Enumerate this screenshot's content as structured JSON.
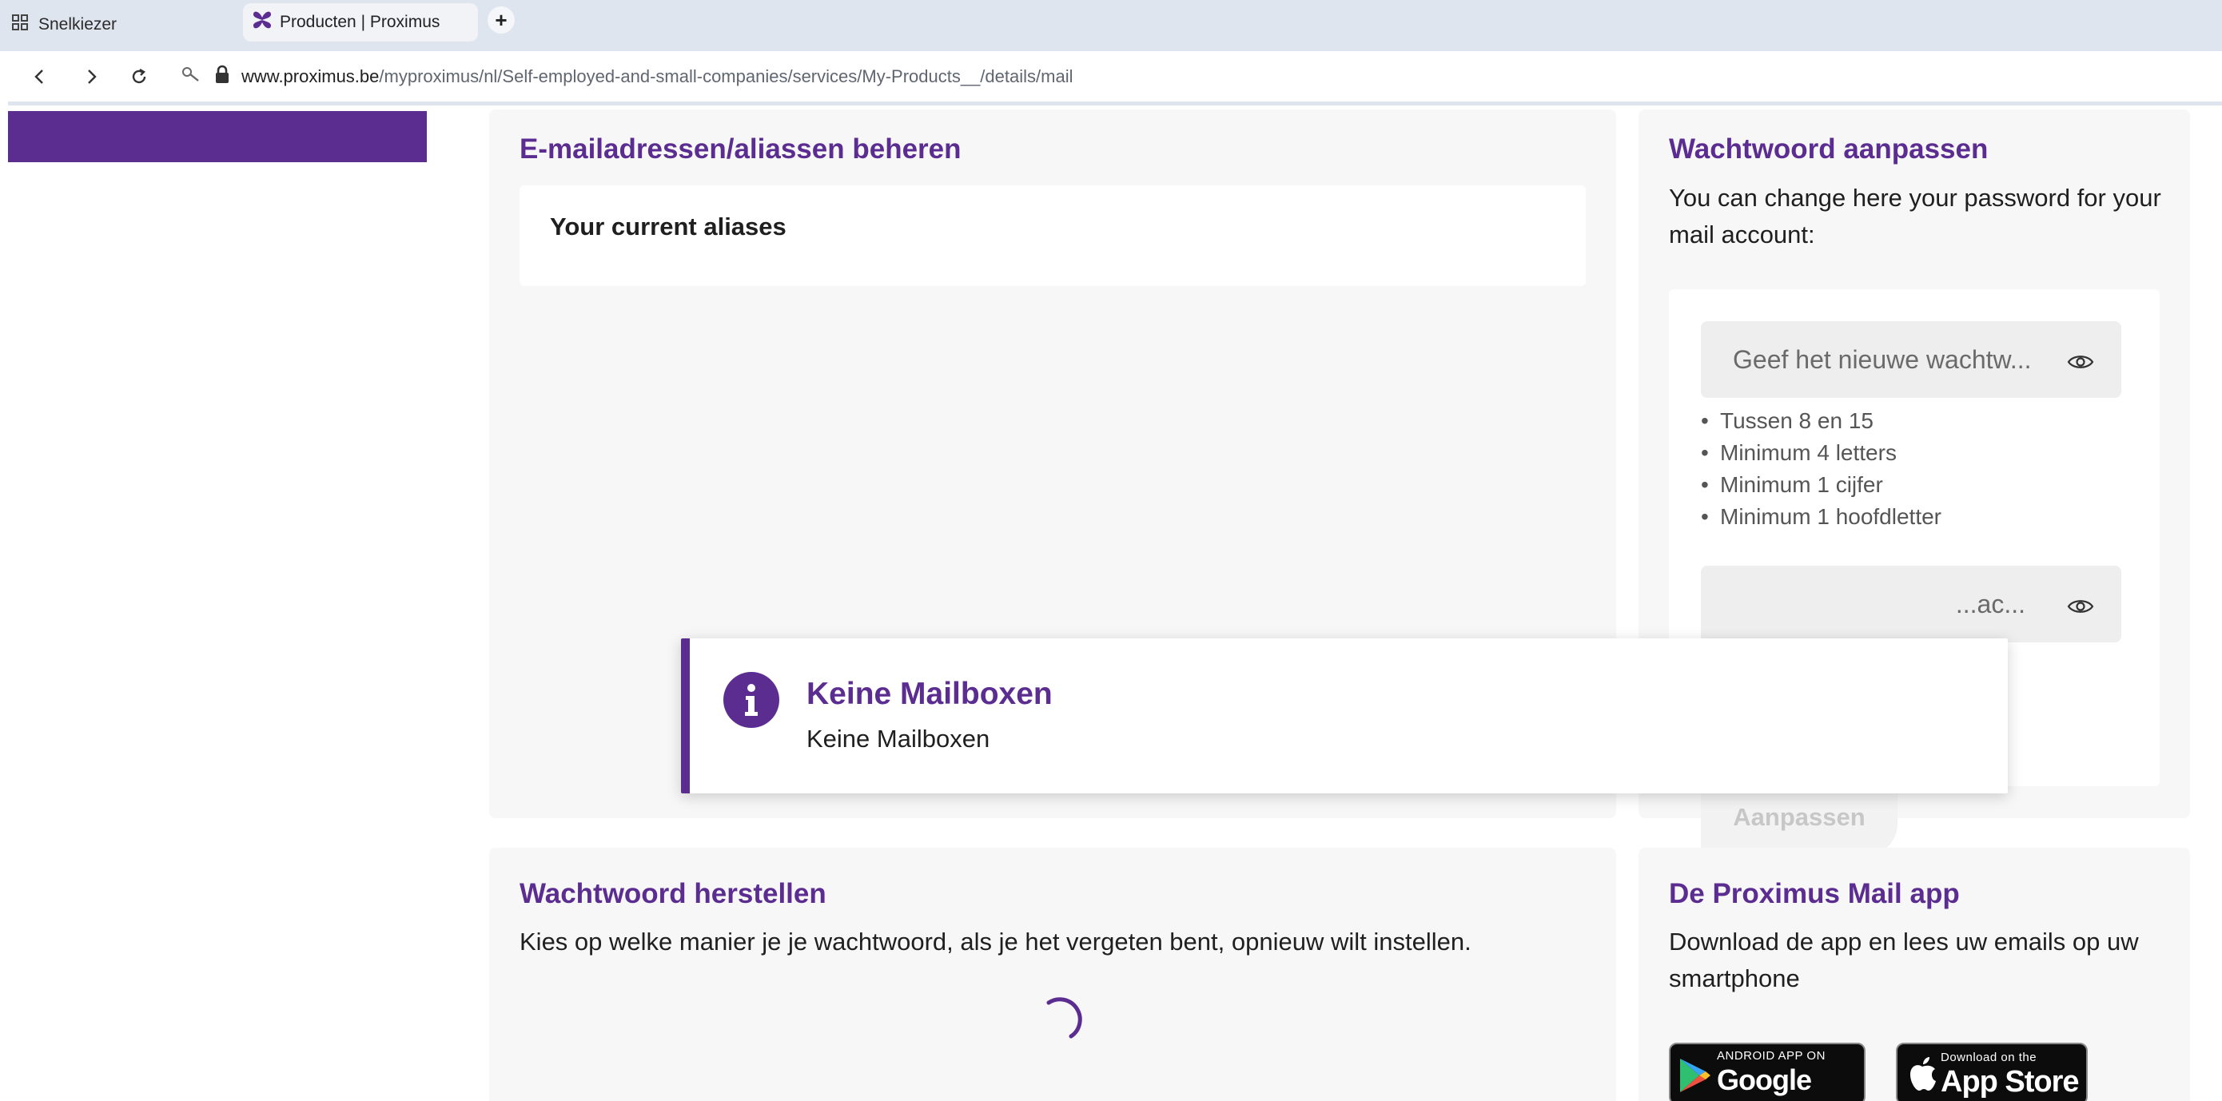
{
  "browser": {
    "tabs": [
      {
        "label": "Snelkiezer",
        "active": false
      },
      {
        "label": "Producten | Proximus",
        "active": true
      }
    ],
    "new_tab_symbol": "+",
    "url": {
      "domain": "www.proximus.be",
      "path": "/myproximus/nl/Self-employed-and-small-companies/services/My-Products__/details/mail"
    }
  },
  "colors": {
    "brand": "#5c2d91"
  },
  "email_card": {
    "title": "E-mailadressen/aliassen beheren",
    "aliases_heading": "Your current aliases"
  },
  "password_card": {
    "title": "Wachtwoord aanpassen",
    "description": "You can change here your password for your mail account:",
    "new_password_placeholder": "Geef het nieuwe wachtw...",
    "confirm_password_placeholder": "...ac...",
    "rules": [
      "Tussen 8 en 15",
      "Minimum 4 letters",
      "Minimum 1 cijfer",
      "Minimum 1 hoofdletter"
    ],
    "submit_label": "Aanpassen"
  },
  "reset_card": {
    "title": "Wachtwoord herstellen",
    "description": "Kies op welke manier je je wachtwoord, als je het vergeten bent, opnieuw wilt instellen."
  },
  "app_card": {
    "title": "De Proximus Mail app",
    "description": "Download de app en lees uw emails op uw smartphone",
    "google_small": "ANDROID APP ON",
    "google_big": "Google play",
    "apple_small": "Download on the",
    "apple_big": "App Store"
  },
  "toast": {
    "title": "Keine Mailboxen",
    "message": "Keine Mailboxen"
  }
}
